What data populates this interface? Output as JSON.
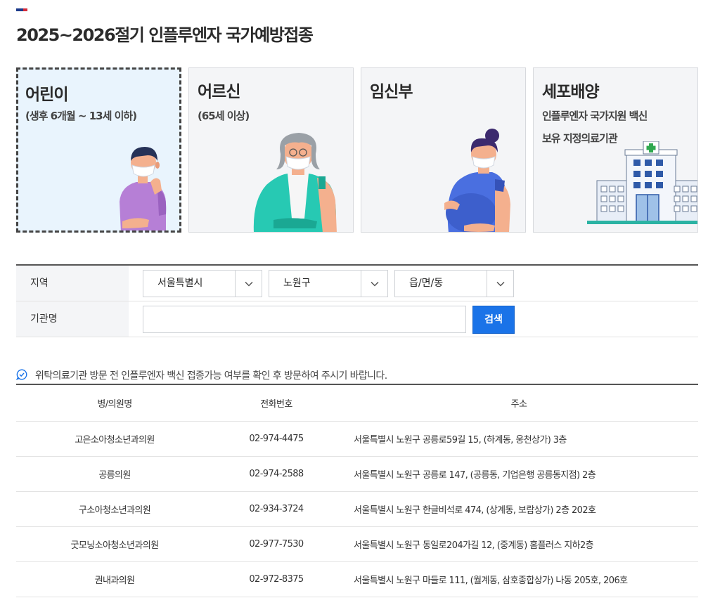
{
  "page": {
    "title": "2025~2026절기 인플루엔자 국가예방접종"
  },
  "categories": [
    {
      "title": "어린이",
      "sub1": "(생후 6개월 ~ 13세 이하)",
      "sub2": "",
      "active": true
    },
    {
      "title": "어르신",
      "sub1": "(65세 이상)",
      "sub2": "",
      "active": false
    },
    {
      "title": "임신부",
      "sub1": "",
      "sub2": "",
      "active": false
    },
    {
      "title": "세포배양",
      "sub1": "인플루엔자 국가지원 백신",
      "sub2": "보유 지정의료기관",
      "active": false
    }
  ],
  "search": {
    "region_label": "지역",
    "sido": "서울특별시",
    "sigungu": "노원구",
    "dong": "읍/면/동",
    "name_label": "기관명",
    "name_value": "",
    "button_label": "검색"
  },
  "notice": "위탁의료기관 방문 전 인플루엔자 백신 접종가능 여부를 확인 후 방문하여 주시기 바랍니다.",
  "table": {
    "headers": [
      "병/의원명",
      "전화번호",
      "주소"
    ],
    "rows": [
      [
        "고은소아청소년과의원",
        "02-974-4475",
        "서울특별시 노원구 공릉로59길 15, (하계동, 웅천상가) 3층"
      ],
      [
        "공릉의원",
        "02-974-2588",
        "서울특별시 노원구 공릉로 147, (공릉동, 기업은행 공릉동지점) 2층"
      ],
      [
        "구소아청소년과의원",
        "02-934-3724",
        "서울특별시 노원구 한글비석로 474, (상계동, 보람상가) 2층 202호"
      ],
      [
        "굿모닝소아청소년과의원",
        "02-977-7530",
        "서울특별시 노원구 동일로204가길 12, (중계동) 홈플러스 지하2층"
      ],
      [
        "권내과의원",
        "02-972-8375",
        "서울특별시 노원구 마들로 111, (월계동, 삼호종합상가) 나동 205호, 206호"
      ]
    ]
  },
  "colors": {
    "accent_blue": "#1a73e8",
    "active_card_bg": "#e9f4fd",
    "card_bg": "#f4f5f7"
  },
  "icons": [
    "chevron-down-icon",
    "info-check-icon",
    "child-illustration",
    "elder-illustration",
    "pregnant-illustration",
    "hospital-illustration"
  ]
}
